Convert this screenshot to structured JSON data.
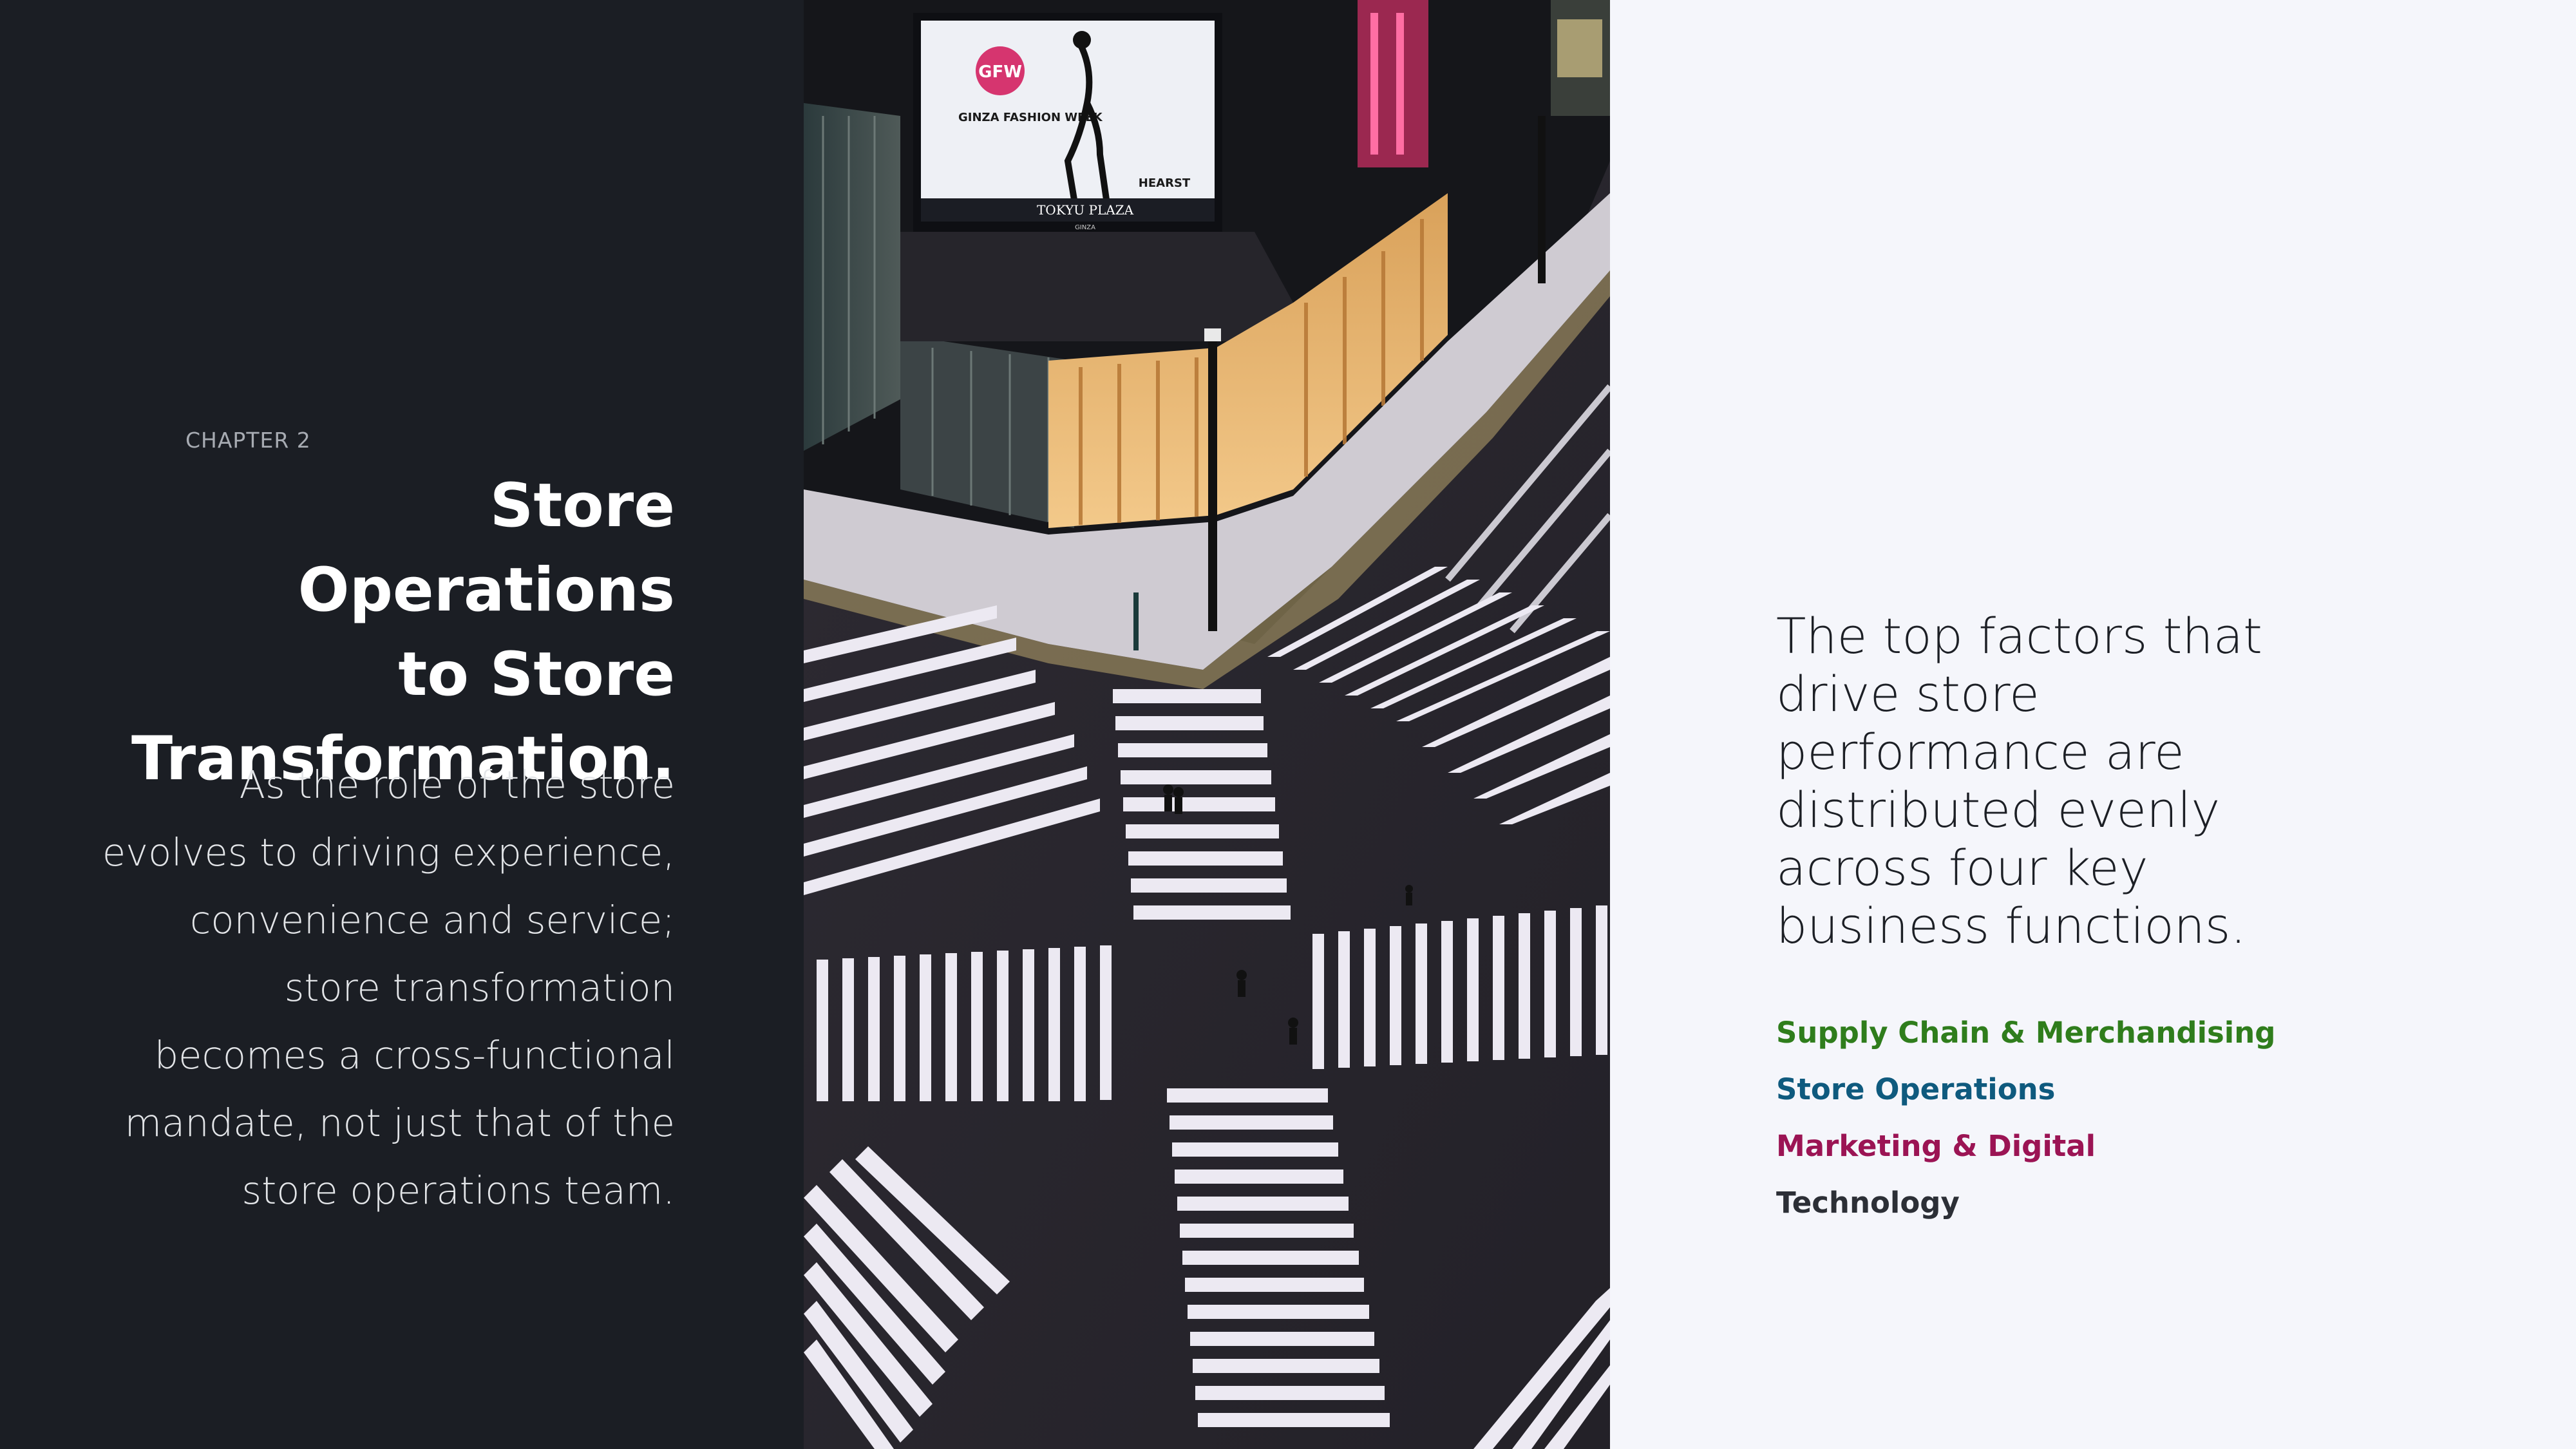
{
  "left": {
    "chapter": "CHAPTER 2",
    "heading_lines": [
      "Store Operations",
      "to Store",
      "Transformation."
    ],
    "body_lines": [
      "As the role of the store",
      "evolves to driving experience,",
      "convenience and service;",
      "store transformation",
      "becomes a cross-functional",
      "mandate, not just that of the",
      "store operations team."
    ]
  },
  "photo": {
    "billboard_brand": "GFW",
    "billboard_line1": "GINZA FASHION WEEK",
    "billboard_sponsor": "HEARST",
    "billboard_building": "TOKYU PLAZA",
    "billboard_district": "GINZA"
  },
  "right": {
    "summary_lines": [
      "The top factors that",
      "drive store",
      "performance are",
      "distributed evenly",
      "across four key",
      "business functions."
    ],
    "functions": [
      {
        "label": "Supply Chain & Merchandising",
        "color": "#2f7d1c"
      },
      {
        "label": "Store Operations",
        "color": "#0f5a7e"
      },
      {
        "label": "Marketing & Digital",
        "color": "#9b1454"
      },
      {
        "label": "Technology",
        "color": "#2c2f36"
      }
    ]
  }
}
